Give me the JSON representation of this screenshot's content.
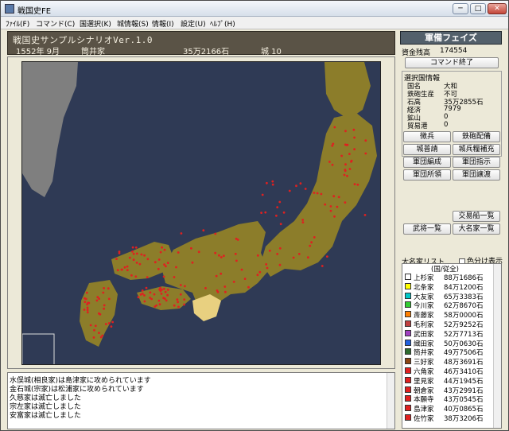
{
  "window": {
    "title": "戦国史FE",
    "min_glyph": "─",
    "max_glyph": "□",
    "close_glyph": "✕"
  },
  "menu": [
    "ﾌｧｲﾙ(F)",
    "コマンド(C)",
    "国選択(K)",
    "城情報(S)",
    "情報(I)",
    "設定(U)",
    "ﾍﾙﾌﾟ(H)"
  ],
  "info": {
    "scenario_title": "戦国史サンプルシナリオVer.1.0",
    "date": "1552年 9月",
    "clan": "筒井家",
    "koku": "35万2166石",
    "castles": "城 10"
  },
  "side": {
    "phase": "軍備フェイズ",
    "funds_label": "資金残高",
    "funds_value": "174554",
    "end_command": "コマンド終了",
    "province_title": "選択国情報",
    "province": [
      {
        "k": "国名",
        "v": "大和"
      },
      {
        "k": "鉄砲生産",
        "v": "不可"
      },
      {
        "k": "石高",
        "v": "35万2855石"
      },
      {
        "k": "経済",
        "v": "7979"
      },
      {
        "k": "鉱山",
        "v": "0"
      },
      {
        "k": "貿易港",
        "v": "0"
      }
    ],
    "buttons": [
      "徴兵",
      "鉄砲配備",
      "城普請",
      "城兵糧補充",
      "軍団編成",
      "軍団指示",
      "軍団所領",
      "軍団譲渡"
    ],
    "trade_ships": "交易船一覧",
    "generals": "武将一覧",
    "daimyo": "大名家一覧",
    "list_title": "大名家リスト",
    "color_toggle": "色分け表示",
    "list_header": "(国/従全)",
    "clans": [
      {
        "name": "上杉家",
        "koku": "88万1686石",
        "color": "#ffffff"
      },
      {
        "name": "北条家",
        "koku": "84万1200石",
        "color": "#ffff00"
      },
      {
        "name": "大友家",
        "koku": "65万3383石",
        "color": "#00c8c8"
      },
      {
        "name": "今川家",
        "koku": "62万8670石",
        "color": "#32cd32"
      },
      {
        "name": "斎藤家",
        "koku": "58万0000石",
        "color": "#ff8000"
      },
      {
        "name": "毛利家",
        "koku": "52万9252石",
        "color": "#c04040"
      },
      {
        "name": "武田家",
        "koku": "52万7713石",
        "color": "#a040c0"
      },
      {
        "name": "織田家",
        "koku": "50万0630石",
        "color": "#2060e0"
      },
      {
        "name": "筒井家",
        "koku": "49万7506石",
        "color": "#2e6b2e"
      },
      {
        "name": "三好家",
        "koku": "48万3691石",
        "color": "#8b4513"
      },
      {
        "name": "六角家",
        "koku": "46万3410石",
        "color": "#e02020"
      },
      {
        "name": "里見家",
        "koku": "44万1945石",
        "color": "#e02020"
      },
      {
        "name": "朝倉家",
        "koku": "43万2991石",
        "color": "#e02020"
      },
      {
        "name": "本願寺",
        "koku": "43万0545石",
        "color": "#e02020"
      },
      {
        "name": "島津家",
        "koku": "40万0865石",
        "color": "#e02020"
      },
      {
        "name": "佐竹家",
        "koku": "38万3206石",
        "color": "#e02020"
      }
    ]
  },
  "log": [
    "水俣城(相良家)は島津家に攻められています",
    "金石城(宗家)は松浦家に攻められています",
    "久慈家は滅亡しました",
    "宗左家は滅亡しました",
    "安富家は滅亡しました"
  ],
  "map_colors": {
    "sea": "#2f3a55",
    "land": "#8c7d2a",
    "continent": "#7f7f7f",
    "castle": "#e02020",
    "border": "#f0f0f0",
    "player": "#e8d080"
  }
}
